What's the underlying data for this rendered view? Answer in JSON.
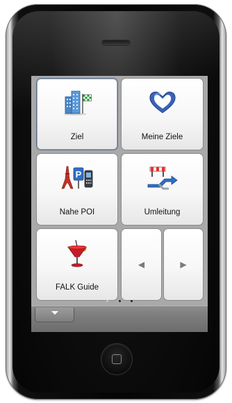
{
  "menu": {
    "destination_label": "Ziel",
    "my_destinations_label": "Meine Ziele",
    "nearby_poi_label": "Nahe POI",
    "detour_label": "Umleitung",
    "falk_guide_label": "FALK Guide"
  },
  "pagination": {
    "pages": 3,
    "current": 2
  },
  "icons": {
    "destination": "buildings-with-checkered-flag-icon",
    "my_destinations": "blue-heart-icon",
    "nearby_poi": "eiffel-tower-parking-phone-icon",
    "detour": "signpost-detour-arrows-icon",
    "falk_guide": "cocktail-glass-icon",
    "prev": "arrow-left-icon",
    "next": "arrow-right-icon",
    "menu": "chevron-down-icon"
  },
  "colors": {
    "selected_border": "#5f6f86",
    "bottom_bar": "#7d7d7d"
  }
}
